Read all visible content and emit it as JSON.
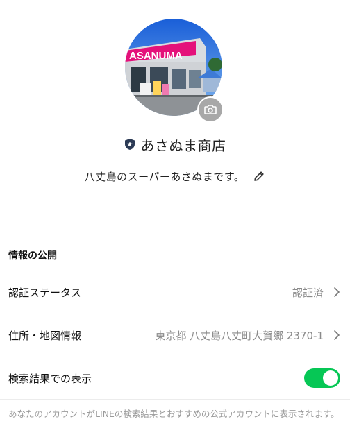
{
  "profile": {
    "storefront_sign": "ASANUMA",
    "name": "あさぬま商店",
    "status_message": "八丈島のスーパーあさぬまです。"
  },
  "info_section": {
    "title": "情報の公開",
    "rows": [
      {
        "label": "認証ステータス",
        "value": "認証済"
      },
      {
        "label": "住所・地図情報",
        "value": "東京都 八丈島八丈町大賀郷 2370-1"
      }
    ],
    "search_toggle": {
      "label": "検索結果での表示",
      "on": true
    },
    "footnote": "あなたのアカウントがLINEの検索結果とおすすめの公式アカウントに表示されます。"
  },
  "colors": {
    "toggle_on": "#06c755",
    "shield_badge": "#2b3a55"
  },
  "icons": [
    "camera-icon",
    "verified-shield-icon",
    "pencil-icon",
    "chevron-right-icon"
  ]
}
